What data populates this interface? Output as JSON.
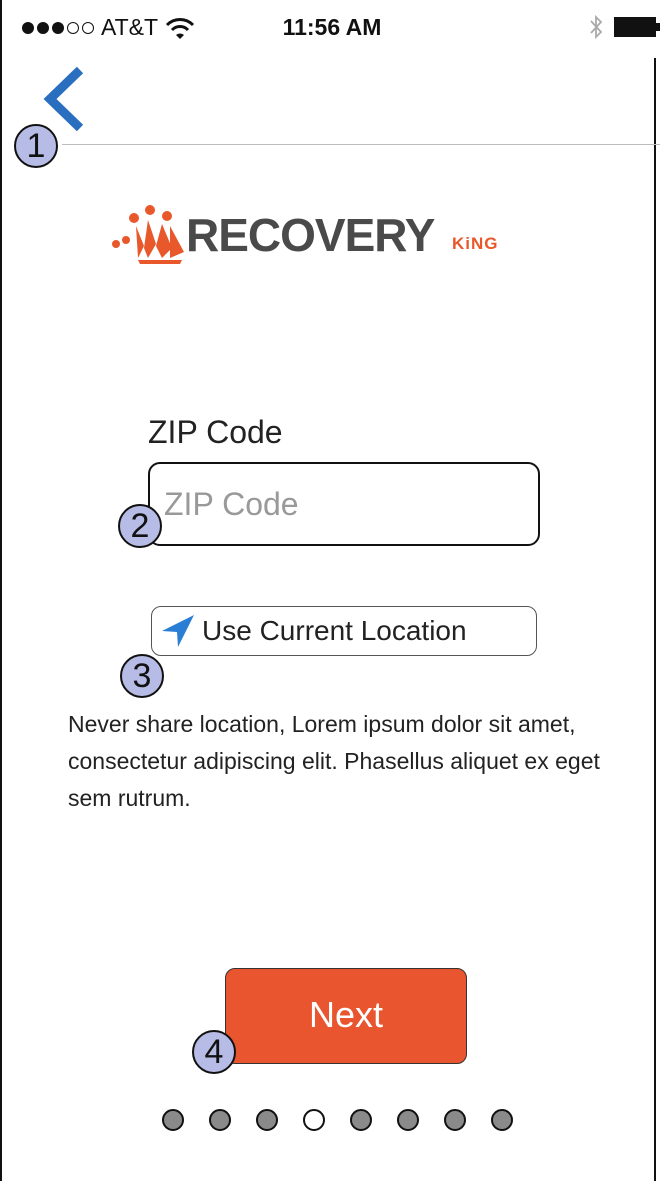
{
  "status_bar": {
    "carrier": "AT&T",
    "time": "11:56 AM"
  },
  "nav": {
    "back_icon": "chevron-left-icon",
    "accent_color": "#2a6fbf"
  },
  "logo": {
    "text": "RECOVERY",
    "sub": "KiNG",
    "color": "#e8582a"
  },
  "annotations": [
    "1",
    "2",
    "3",
    "4"
  ],
  "zip": {
    "label": "ZIP Code",
    "placeholder": "ZIP Code",
    "value": ""
  },
  "location_button": {
    "label": "Use Current Location",
    "icon": "location-arrow-icon"
  },
  "description": "Never share location,  Lorem ipsum dolor sit amet, consectetur adipiscing elit. Phasellus aliquet ex eget sem rutrum.",
  "next_button": {
    "label": "Next",
    "color": "#e8552f"
  },
  "pager": {
    "total": 8,
    "active_index": 3
  }
}
